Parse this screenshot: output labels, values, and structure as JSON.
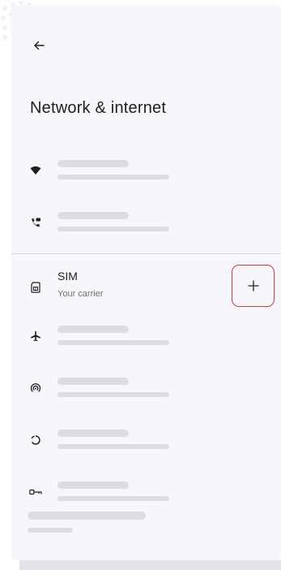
{
  "header": {
    "back_icon": "arrow-back-icon",
    "title": "Network & internet"
  },
  "rows": [
    {
      "icon": "wifi-icon",
      "placeholder": true
    },
    {
      "icon": "calls-sms-icon",
      "placeholder": true
    },
    {
      "icon": "sim-card-icon",
      "title": "SIM",
      "subtitle": "Your carrier",
      "action_icon": "plus-icon"
    },
    {
      "icon": "airplane-icon",
      "placeholder": true
    },
    {
      "icon": "hotspot-icon",
      "placeholder": true
    },
    {
      "icon": "data-saver-icon",
      "placeholder": true
    },
    {
      "icon": "vpn-key-icon",
      "placeholder": true
    }
  ],
  "colors": {
    "background": "#f7f7fb",
    "placeholder": "#dcdde3",
    "highlight": "#d23a47",
    "text": "#1f1f1f",
    "secondary_text": "#6f7076"
  }
}
